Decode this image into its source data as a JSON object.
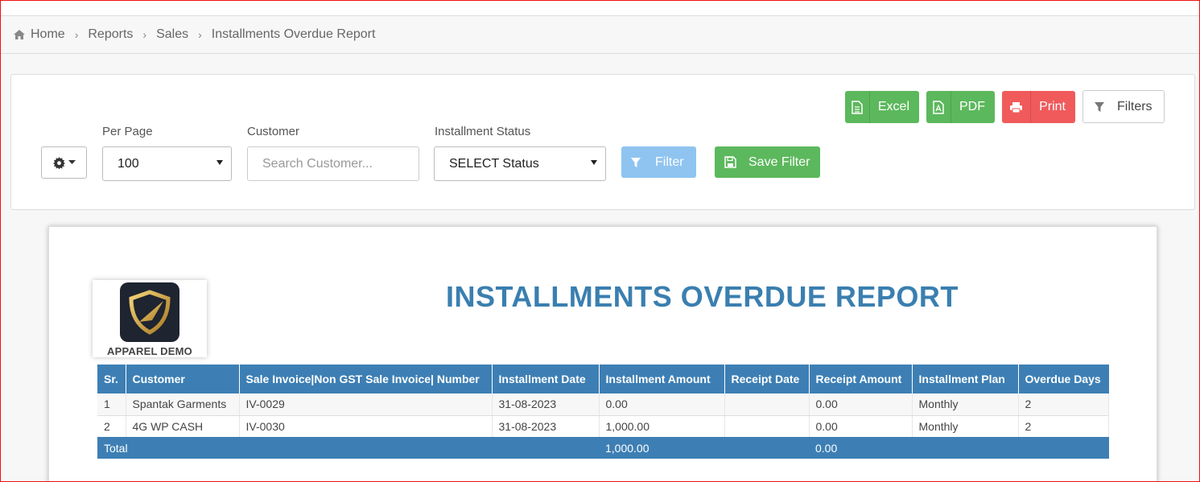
{
  "breadcrumb": {
    "home": "Home",
    "items": [
      "Reports",
      "Sales",
      "Installments Overdue Report"
    ]
  },
  "toolbar": {
    "excel": "Excel",
    "pdf": "PDF",
    "print": "Print",
    "filters": "Filters"
  },
  "form": {
    "per_page_label": "Per Page",
    "per_page_value": "100",
    "customer_label": "Customer",
    "customer_placeholder": "Search Customer...",
    "status_label": "Installment Status",
    "status_value": "SELECT Status",
    "filter_button": "Filter",
    "save_filter_button": "Save Filter"
  },
  "report": {
    "company": "APPAREL DEMO",
    "title": "INSTALLMENTS OVERDUE REPORT",
    "columns": [
      "Sr.",
      "Customer",
      "Sale Invoice|Non GST Sale Invoice| Number",
      "Installment Date",
      "Installment Amount",
      "Receipt Date",
      "Receipt Amount",
      "Installment Plan",
      "Overdue Days"
    ],
    "rows": [
      [
        "1",
        "Spantak Garments",
        "IV-0029",
        "31-08-2023",
        "0.00",
        "",
        "0.00",
        "Monthly",
        "2"
      ],
      [
        "2",
        "4G WP CASH",
        "IV-0030",
        "31-08-2023",
        "1,000.00",
        "",
        "0.00",
        "Monthly",
        "2"
      ]
    ],
    "total": {
      "label": "Total",
      "installment_amount": "1,000.00",
      "receipt_amount": "0.00"
    }
  },
  "colors": {
    "header_blue": "#3d7fb4",
    "title_blue": "#3a7fb0",
    "green": "#5cb85c",
    "red": "#f05a5b",
    "light_blue": "#8fc4f0"
  },
  "icons": [
    "home-icon",
    "excel-file-icon",
    "pdf-file-icon",
    "print-icon",
    "filter-icon",
    "gear-icon",
    "save-icon"
  ]
}
